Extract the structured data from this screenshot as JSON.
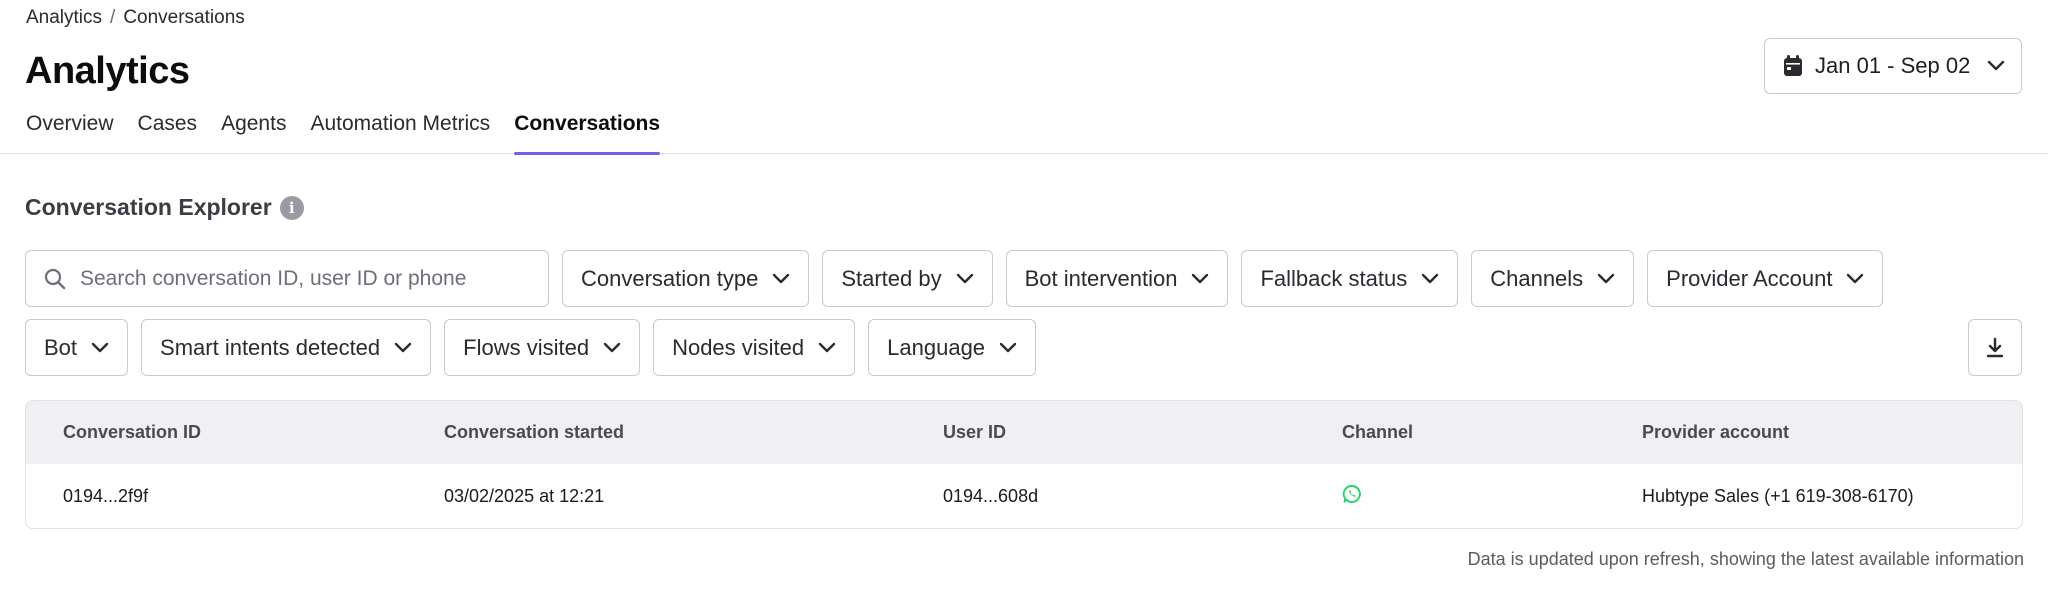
{
  "breadcrumb": {
    "items": [
      "Analytics",
      "Conversations"
    ],
    "separator": "/"
  },
  "page": {
    "title": "Analytics"
  },
  "date_picker": {
    "label": "Jan 01 - Sep 02"
  },
  "tabs": [
    {
      "label": "Overview",
      "active": false
    },
    {
      "label": "Cases",
      "active": false
    },
    {
      "label": "Agents",
      "active": false
    },
    {
      "label": "Automation Metrics",
      "active": false
    },
    {
      "label": "Conversations",
      "active": true
    }
  ],
  "section": {
    "title": "Conversation Explorer"
  },
  "search": {
    "placeholder": "Search conversation ID, user ID or phone",
    "value": ""
  },
  "filters_row1": [
    "Conversation type",
    "Started by",
    "Bot intervention",
    "Fallback status",
    "Channels",
    "Provider Account"
  ],
  "filters_row2": [
    "Bot",
    "Smart intents detected",
    "Flows visited",
    "Nodes visited",
    "Language"
  ],
  "table": {
    "columns": [
      "Conversation ID",
      "Conversation started",
      "User ID",
      "Channel",
      "Provider account"
    ],
    "rows": [
      {
        "conversation_id": "0194...2f9f",
        "started": "03/02/2025 at 12:21",
        "user_id": "0194...608d",
        "channel_icon": "whatsapp-icon",
        "provider": "Hubtype Sales (+1 619-308-6170)"
      }
    ]
  },
  "footer": {
    "note": "Data is updated upon refresh, showing the latest available information"
  },
  "colors": {
    "accent": "#7b5cf0",
    "whatsapp": "#25d366",
    "border": "#c9c9cf",
    "header_bg": "#f0f0f2"
  }
}
